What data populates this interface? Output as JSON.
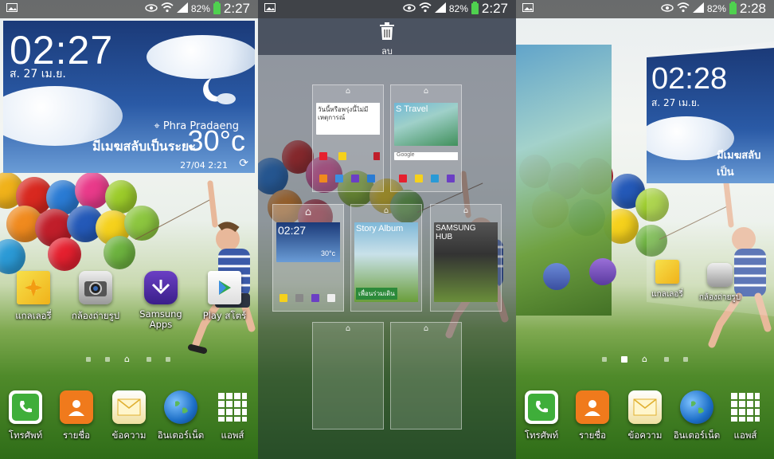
{
  "status": {
    "screen1": {
      "battery": "82%",
      "time": "2:27"
    },
    "screen2": {
      "battery": "82%",
      "time": "2:27"
    },
    "screen3": {
      "battery": "82%",
      "time": "2:28"
    }
  },
  "weather_widget": {
    "time": "02:27",
    "date": "ส. 27 เม.ย.",
    "location": "Phra Pradaeng",
    "condition": "มีเมฆสลับเป็นระยะ",
    "temperature": "30°c",
    "updated": "27/04 2:21"
  },
  "home_apps": [
    {
      "label": "แกลเลอรี่",
      "icon": "gallery-icon"
    },
    {
      "label": "กล้องถ่ายรูป",
      "icon": "camera-icon"
    },
    {
      "label": "Samsung Apps",
      "icon": "samsung-apps-icon"
    },
    {
      "label": "Play สโตร์",
      "icon": "play-store-icon"
    }
  ],
  "dock": [
    {
      "label": "โทรศัพท์",
      "icon": "phone-icon"
    },
    {
      "label": "รายชื่อ",
      "icon": "contacts-icon"
    },
    {
      "label": "ข้อความ",
      "icon": "messages-icon"
    },
    {
      "label": "อินเตอร์เน็ต",
      "icon": "internet-icon"
    },
    {
      "label": "แอพส์",
      "icon": "apps-grid-icon"
    }
  ],
  "edit_mode": {
    "delete_label": "ลบ",
    "thumb1_text": "วันนี้หรือพรุ่งนี้ไม่มีเหตุการณ์",
    "thumb2_title": "S Travel",
    "thumb2_search": "Google",
    "thumb3_time": "02:27",
    "thumb3_temp": "30°c",
    "thumb4_title": "Story Album",
    "thumb4_caption": "เพื่อนร่วมเดิน",
    "thumb5_title": "SAMSUNG HUB"
  },
  "screen3": {
    "time": "02:28",
    "date": "ส. 27 เม.ย.",
    "condition": "มีเมฆสลับเป็น",
    "apps": [
      {
        "label": "แกลเลอรี่",
        "icon": "gallery-icon"
      },
      {
        "label": "กล้องถ่ายรูป",
        "icon": "camera-icon"
      }
    ]
  },
  "colors": {
    "phone": "#3fae3a",
    "contacts": "#f07a1c",
    "messages": "#f5c23a",
    "internet": "#1d6fc7",
    "battery": "#4fd14f"
  }
}
